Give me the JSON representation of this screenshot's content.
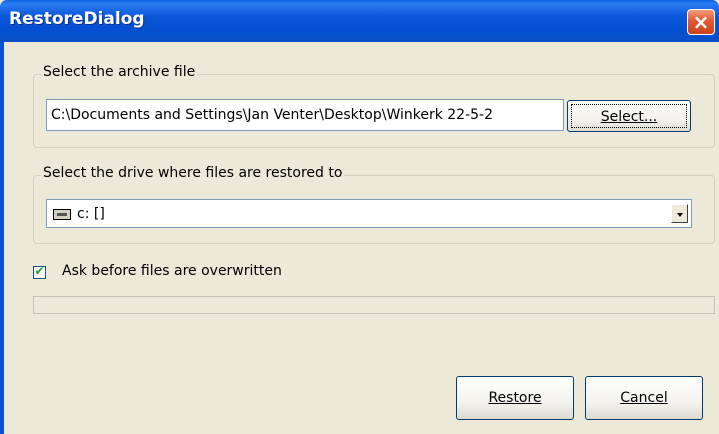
{
  "window": {
    "title": "RestoreDialog",
    "close_label": "×"
  },
  "archive_group": {
    "label": "Select the archive file",
    "path_value": "C:\\Documents and Settings\\Jan Venter\\Desktop\\Winkerk 22-5-2",
    "select_button_label": "Select..."
  },
  "drive_group": {
    "label": "Select the drive where files are restored to",
    "selected_drive": "c: []",
    "drive_icon": "drive-icon"
  },
  "options": {
    "ask_overwrite_label": "Ask before files are overwritten",
    "ask_overwrite_checked": true,
    "check_mark": "✔"
  },
  "progress": {
    "value": 0
  },
  "actions": {
    "restore_label": "Restore",
    "cancel_label": "Cancel"
  },
  "colors": {
    "titlebar": "#0a56d8",
    "dialog_bg": "#ece9d8",
    "close_button": "#e05a32"
  }
}
